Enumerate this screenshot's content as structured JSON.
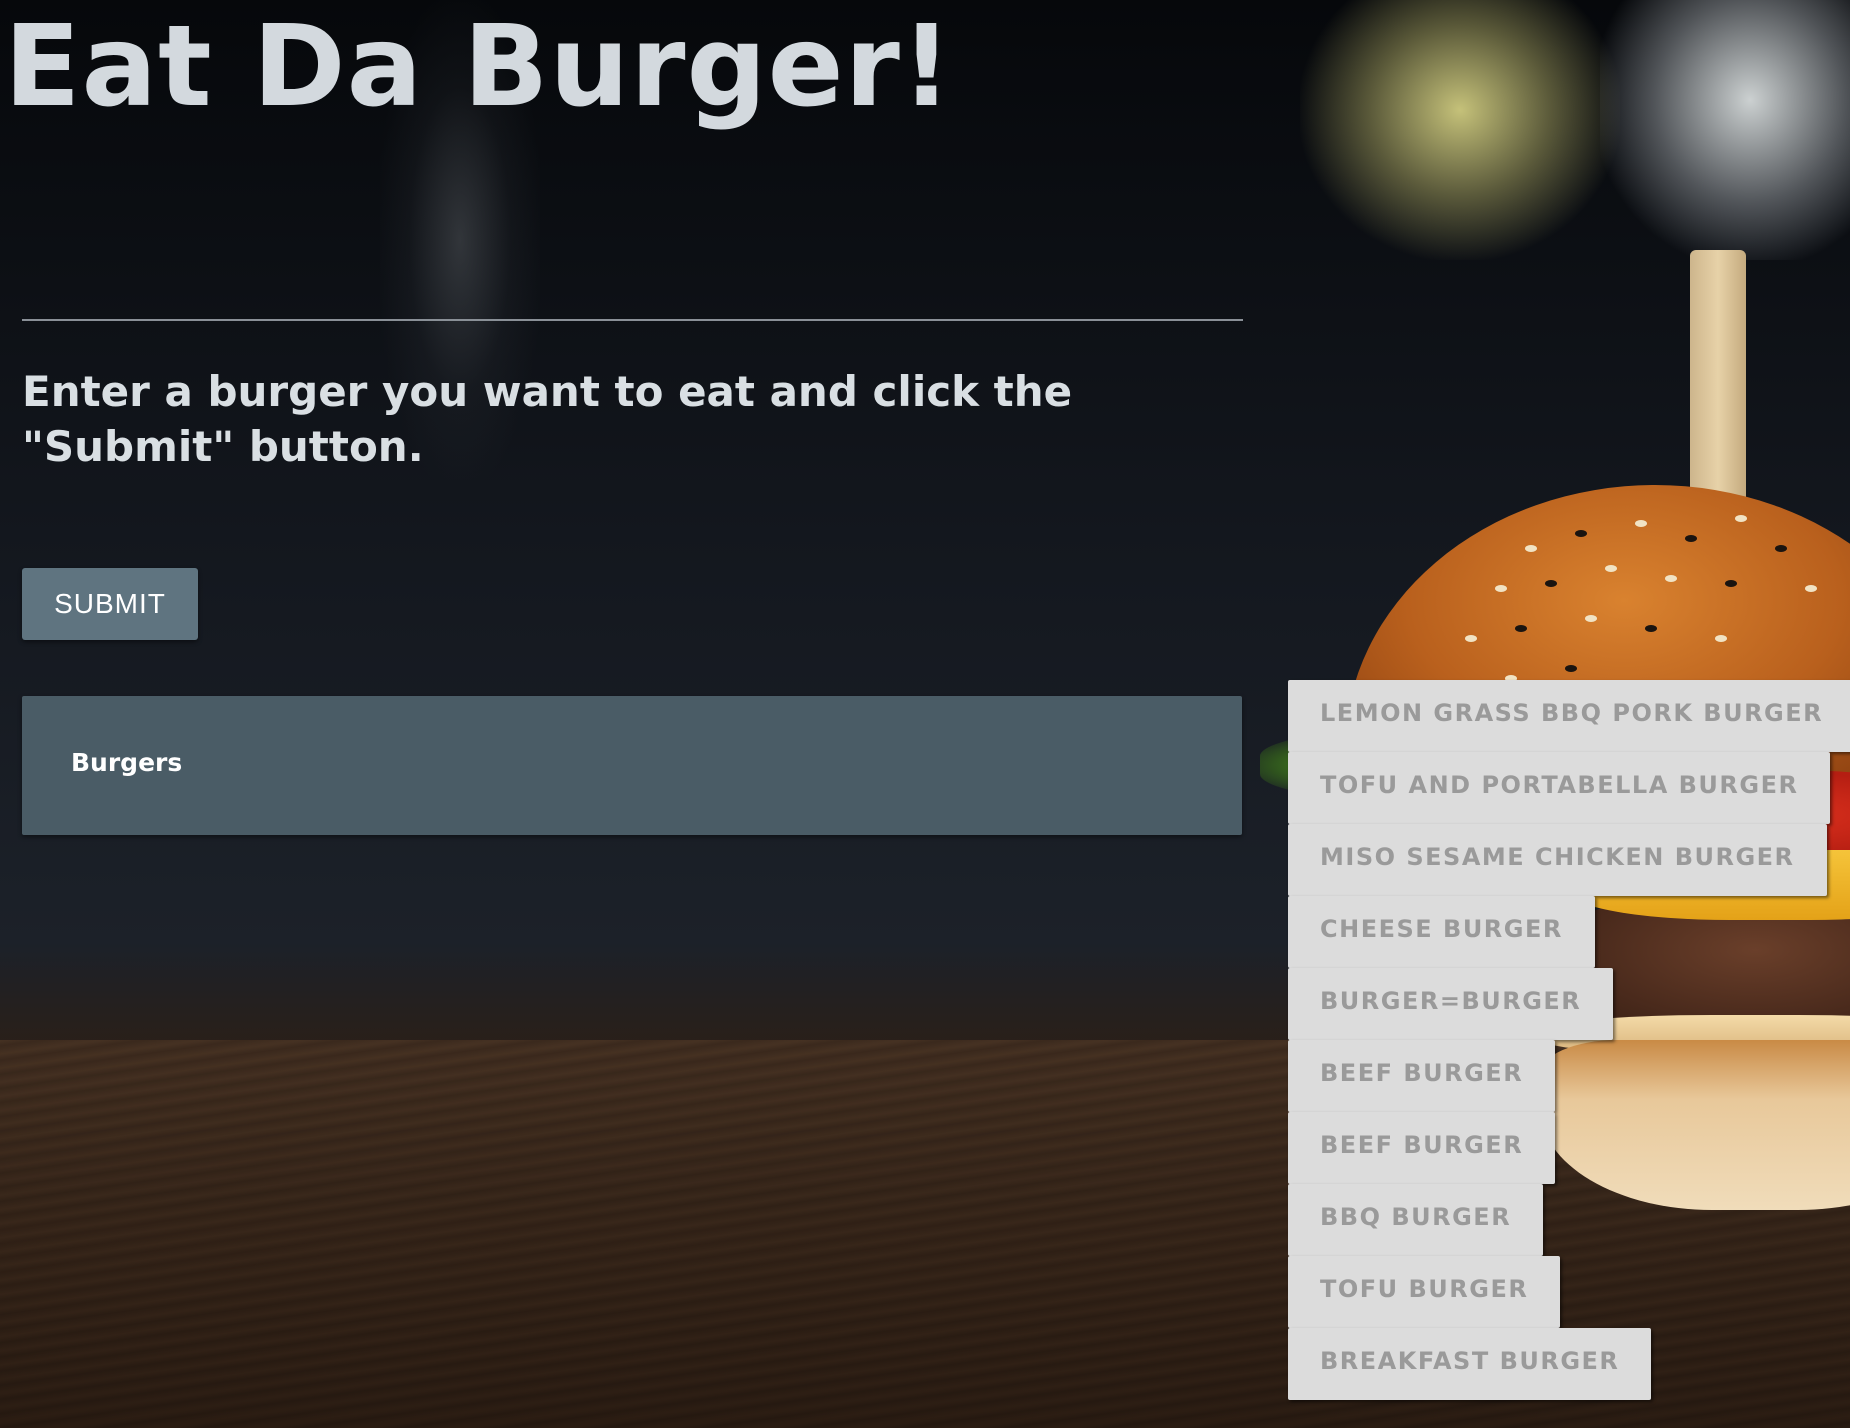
{
  "page": {
    "title": "Eat Da Burger!",
    "prompt": "Enter a burger you want to eat and click the \"Submit\" button."
  },
  "form": {
    "submit_label": "SUBMIT"
  },
  "panel": {
    "heading": "Burgers"
  },
  "burgers": [
    "LEMON GRASS BBQ PORK BURGER",
    "TOFU AND PORTABELLA BURGER",
    "MISO SESAME CHICKEN BURGER",
    "CHEESE BURGER",
    "BURGER=BURGER",
    "BEEF BURGER",
    "BEEF BURGER",
    "BBQ BURGER",
    "TOFU BURGER",
    "BREAKFAST BURGER"
  ],
  "colors": {
    "title": "#d3d9de",
    "button_bg": "#5f7480",
    "panel_bg": "#4a5c66",
    "item_bg": "#dcdcdc",
    "item_text": "#9a9a9a"
  }
}
